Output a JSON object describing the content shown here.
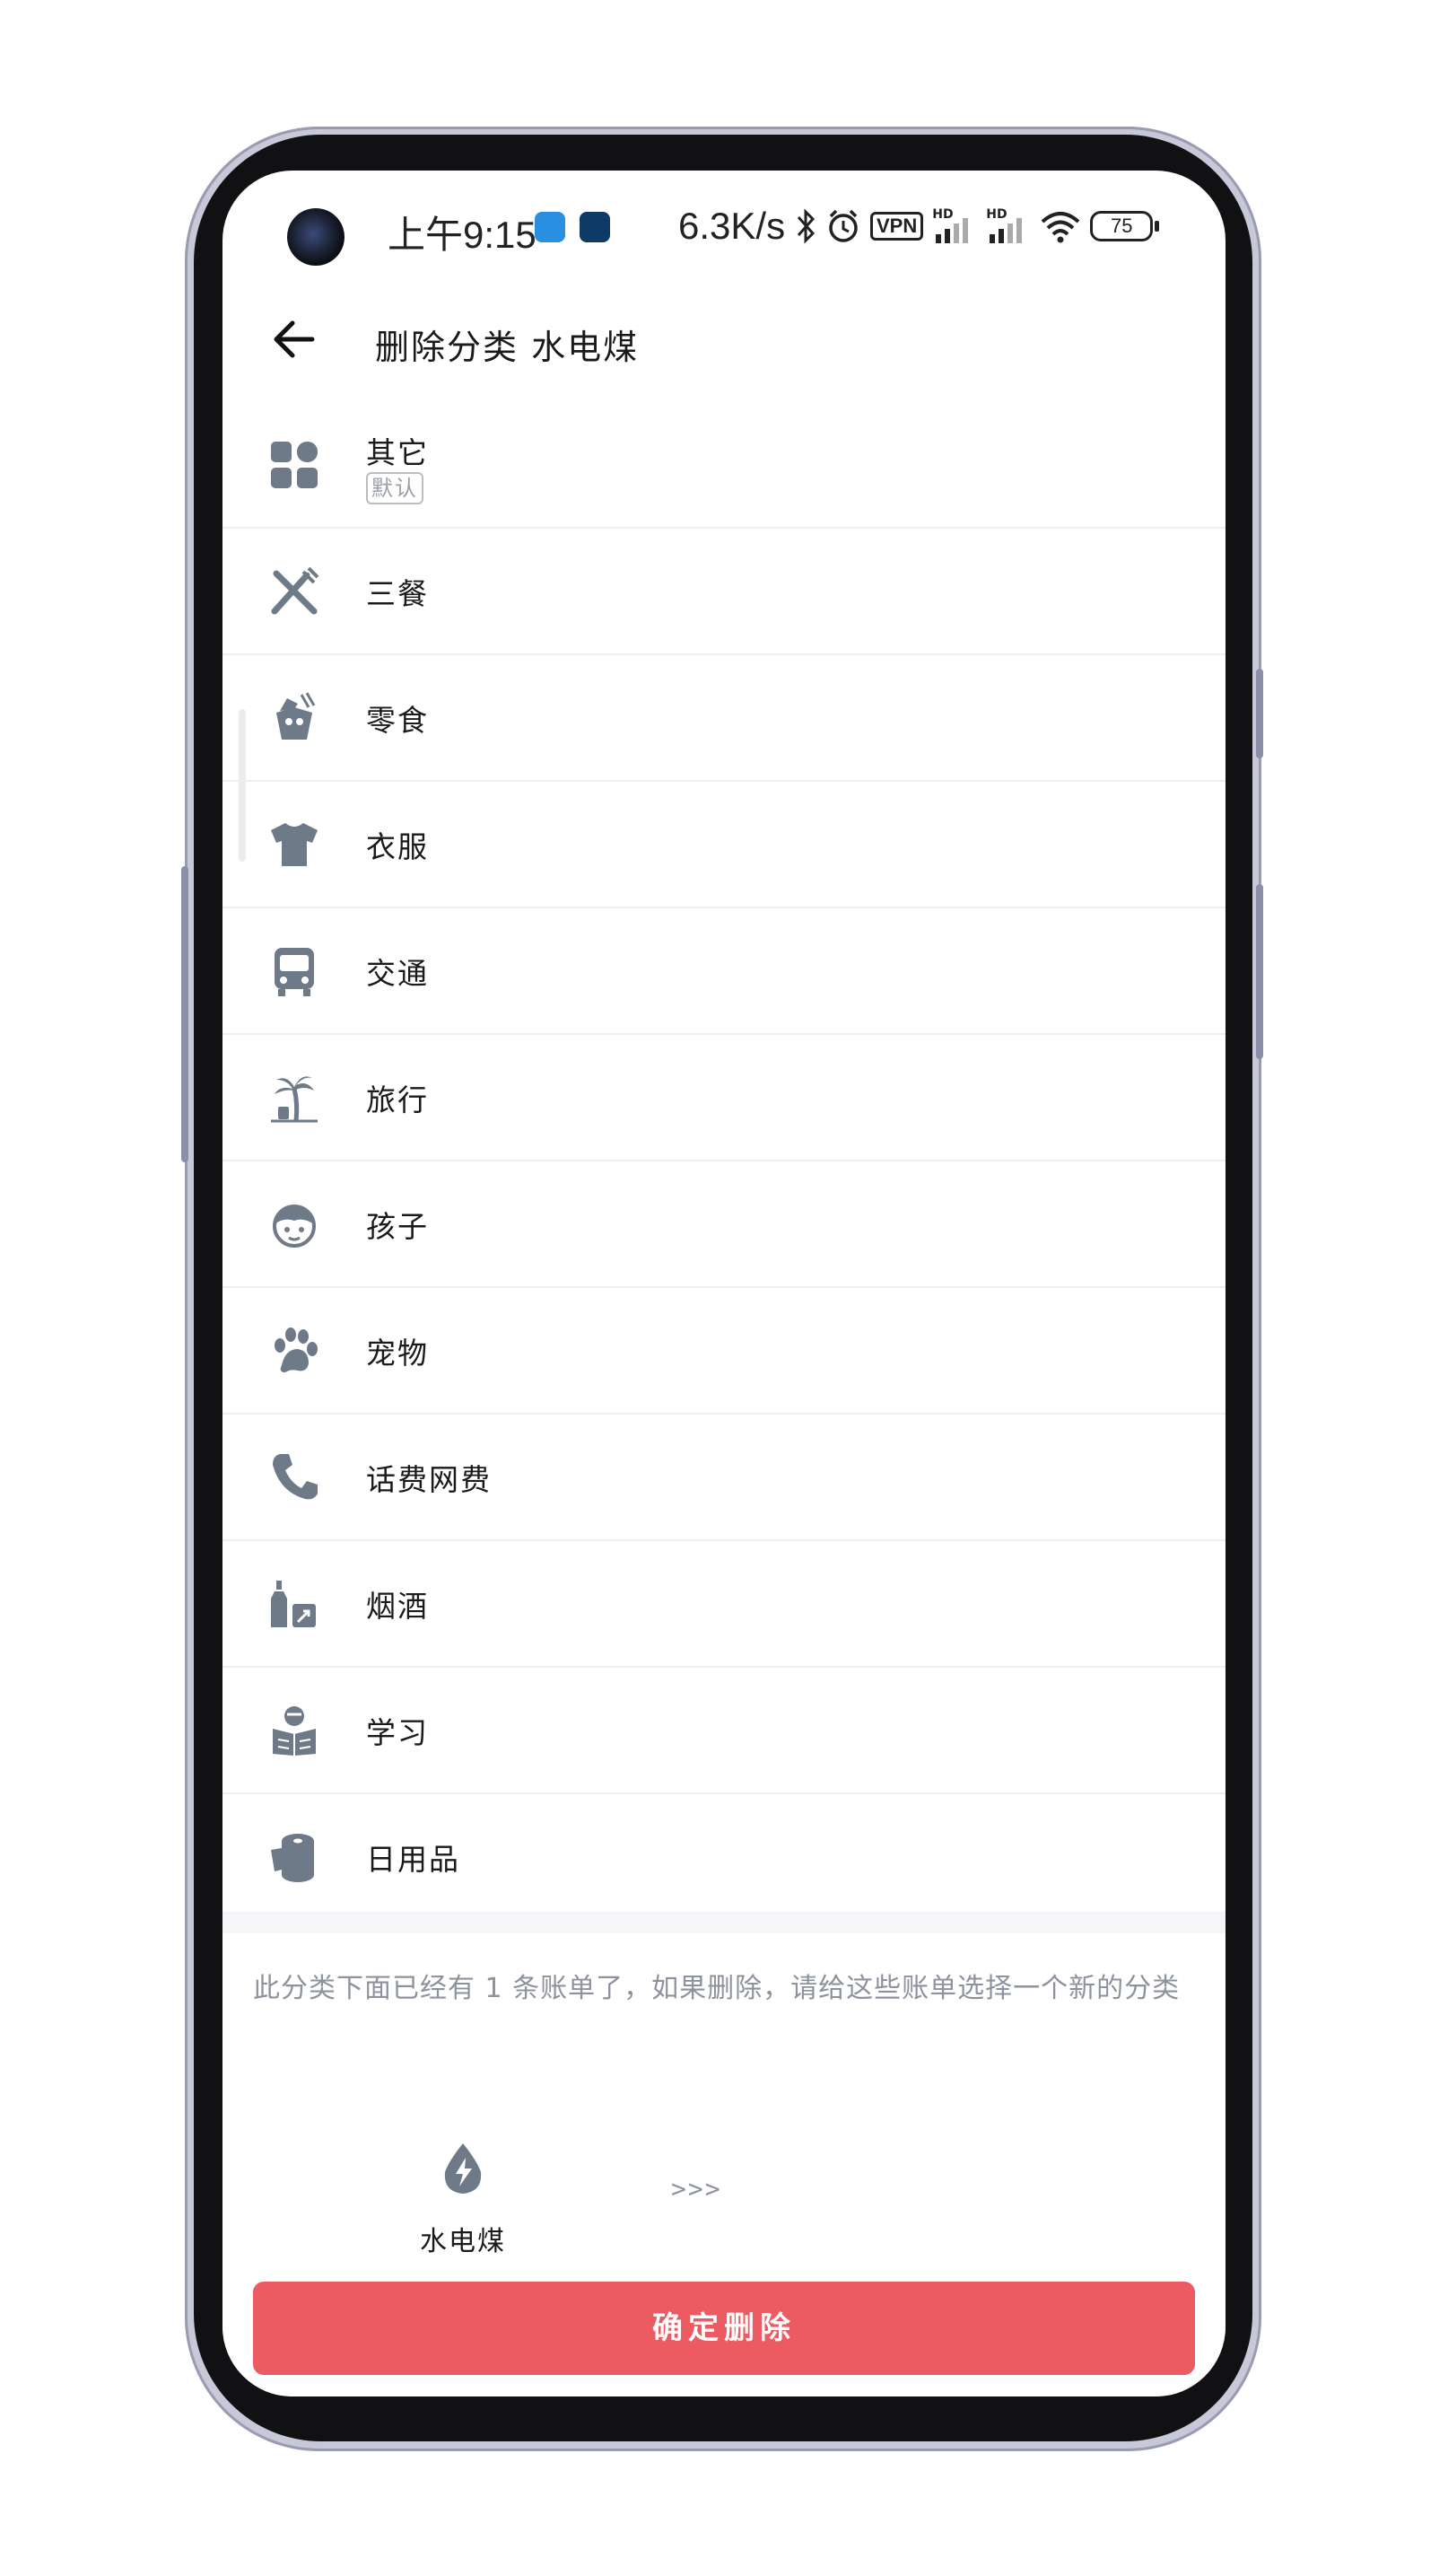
{
  "status_bar": {
    "time": "上午9:15",
    "net_speed": "6.3K/s",
    "vpn": "VPN",
    "hd1": "HD",
    "hd2": "HD",
    "battery": "75"
  },
  "header": {
    "title": "删除分类 水电煤",
    "back_icon": "arrow-left-icon"
  },
  "categories": [
    {
      "label": "其它",
      "badge": "默认",
      "icon": "grid-icon"
    },
    {
      "label": "三餐",
      "icon": "fork-knife-icon"
    },
    {
      "label": "零食",
      "icon": "snack-box-icon"
    },
    {
      "label": "衣服",
      "icon": "tshirt-icon"
    },
    {
      "label": "交通",
      "icon": "bus-icon"
    },
    {
      "label": "旅行",
      "icon": "palm-tree-icon"
    },
    {
      "label": "孩子",
      "icon": "child-face-icon"
    },
    {
      "label": "宠物",
      "icon": "paw-icon"
    },
    {
      "label": "话费网费",
      "icon": "phone-icon"
    },
    {
      "label": "烟酒",
      "icon": "bottle-icon"
    },
    {
      "label": "学习",
      "icon": "reading-icon"
    },
    {
      "label": "日用品",
      "icon": "tissue-roll-icon"
    }
  ],
  "notice": "此分类下面已经有 1 条账单了，如果删除，请给这些账单选择一个新的分类",
  "source_category": {
    "label": "水电煤",
    "icon": "water-bolt-icon"
  },
  "arrows": ">>>",
  "confirm_button": "确定删除",
  "colors": {
    "accent": "#ec5a62",
    "icon_gray": "#6f7a89"
  }
}
